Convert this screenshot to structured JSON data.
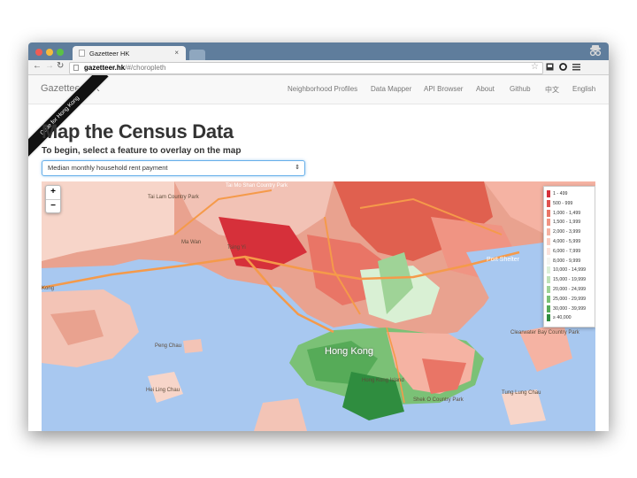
{
  "browser": {
    "tab_title": "Gazetteer HK",
    "tab_close": "×",
    "url_host": "gazetteer.hk",
    "url_path": "/#/choropleth",
    "star": "☆"
  },
  "navbar": {
    "brand": "Gazetteer HK",
    "items": [
      "Neighborhood Profiles",
      "Data Mapper",
      "API Browser",
      "About",
      "Github",
      "中文",
      "English"
    ]
  },
  "ribbon": "Code for Hong Kong",
  "page": {
    "heading": "Map the Census Data",
    "subheading": "To begin, select a feature to overlay on the map",
    "select_value": "Median monthly household rent payment"
  },
  "map": {
    "zoom_in": "+",
    "zoom_out": "−",
    "legend": [
      {
        "label": "1 - 499",
        "color": "#d6303a"
      },
      {
        "label": "500 - 999",
        "color": "#e0524f"
      },
      {
        "label": "1,000 - 1,499",
        "color": "#e97566"
      },
      {
        "label": "1,500 - 1,999",
        "color": "#f09483"
      },
      {
        "label": "2,000 - 3,999",
        "color": "#f5b3a3"
      },
      {
        "label": "4,000 - 5,999",
        "color": "#f9cdc1"
      },
      {
        "label": "6,000 - 7,999",
        "color": "#fbe3dc"
      },
      {
        "label": "8,000 - 9,999",
        "color": "#f5f5f0"
      },
      {
        "label": "10,000 - 14,999",
        "color": "#dcefd8"
      },
      {
        "label": "15,000 - 19,999",
        "color": "#bfe2b8"
      },
      {
        "label": "20,000 - 24,999",
        "color": "#9fd397"
      },
      {
        "label": "25,000 - 29,999",
        "color": "#7bc176"
      },
      {
        "label": "30,000 - 39,999",
        "color": "#56ab58"
      },
      {
        "label": "≥ 40,000",
        "color": "#2f8d3f"
      }
    ],
    "labels": {
      "tai_mo_shan": "Tai Mo Shan Country Park",
      "tai_lam": "Tai Lam Country Park",
      "ma_wan": "Ma Wan",
      "port_shelter": "Port Shelter",
      "clear_water_bay": "Clearwater Bay Country Park",
      "peng_chau": "Peng Chau",
      "hei_ling_chau": "Hei Ling Chau",
      "hong_kong": "Hong Kong",
      "hk_island": "Hong Kong Island",
      "tung_lung": "Tung Lung Chau",
      "shek_o": "Shek O Country Park",
      "tsing_yi": "Tsing Yi",
      "kong": "Kong"
    }
  }
}
